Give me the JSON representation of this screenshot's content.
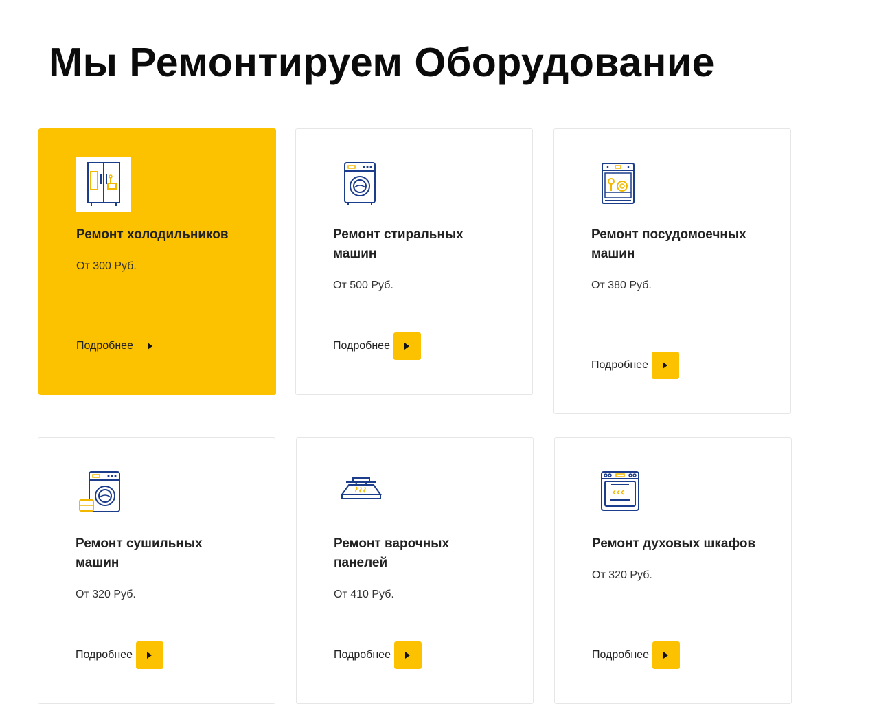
{
  "page": {
    "title": "Мы Ремонтируем Оборудование"
  },
  "colors": {
    "accent": "#fcc200",
    "icon_primary": "#1c3c8c",
    "text": "#222222"
  },
  "cards": [
    {
      "title": "Ремонт холодильников",
      "price": "От 300 Руб.",
      "more_label": "Подробнее",
      "icon": "fridge-icon"
    },
    {
      "title": "Ремонт стиральных машин",
      "price": "От 500 Руб.",
      "more_label": "Подробнее",
      "icon": "washing-machine-icon"
    },
    {
      "title": "Ремонт посудомоечных машин",
      "price": "От 380 Руб.",
      "more_label": "Подробнее",
      "icon": "dishwasher-icon"
    },
    {
      "title": "Ремонт сушильных машин",
      "price": "От 320 Руб.",
      "more_label": "Подробнее",
      "icon": "dryer-icon"
    },
    {
      "title": "Ремонт варочных панелей",
      "price": "От 410 Руб.",
      "more_label": "Подробнее",
      "icon": "cooktop-hood-icon"
    },
    {
      "title": "Ремонт духовых шкафов",
      "price": "От 320 Руб.",
      "more_label": "Подробнее",
      "icon": "oven-icon"
    }
  ]
}
